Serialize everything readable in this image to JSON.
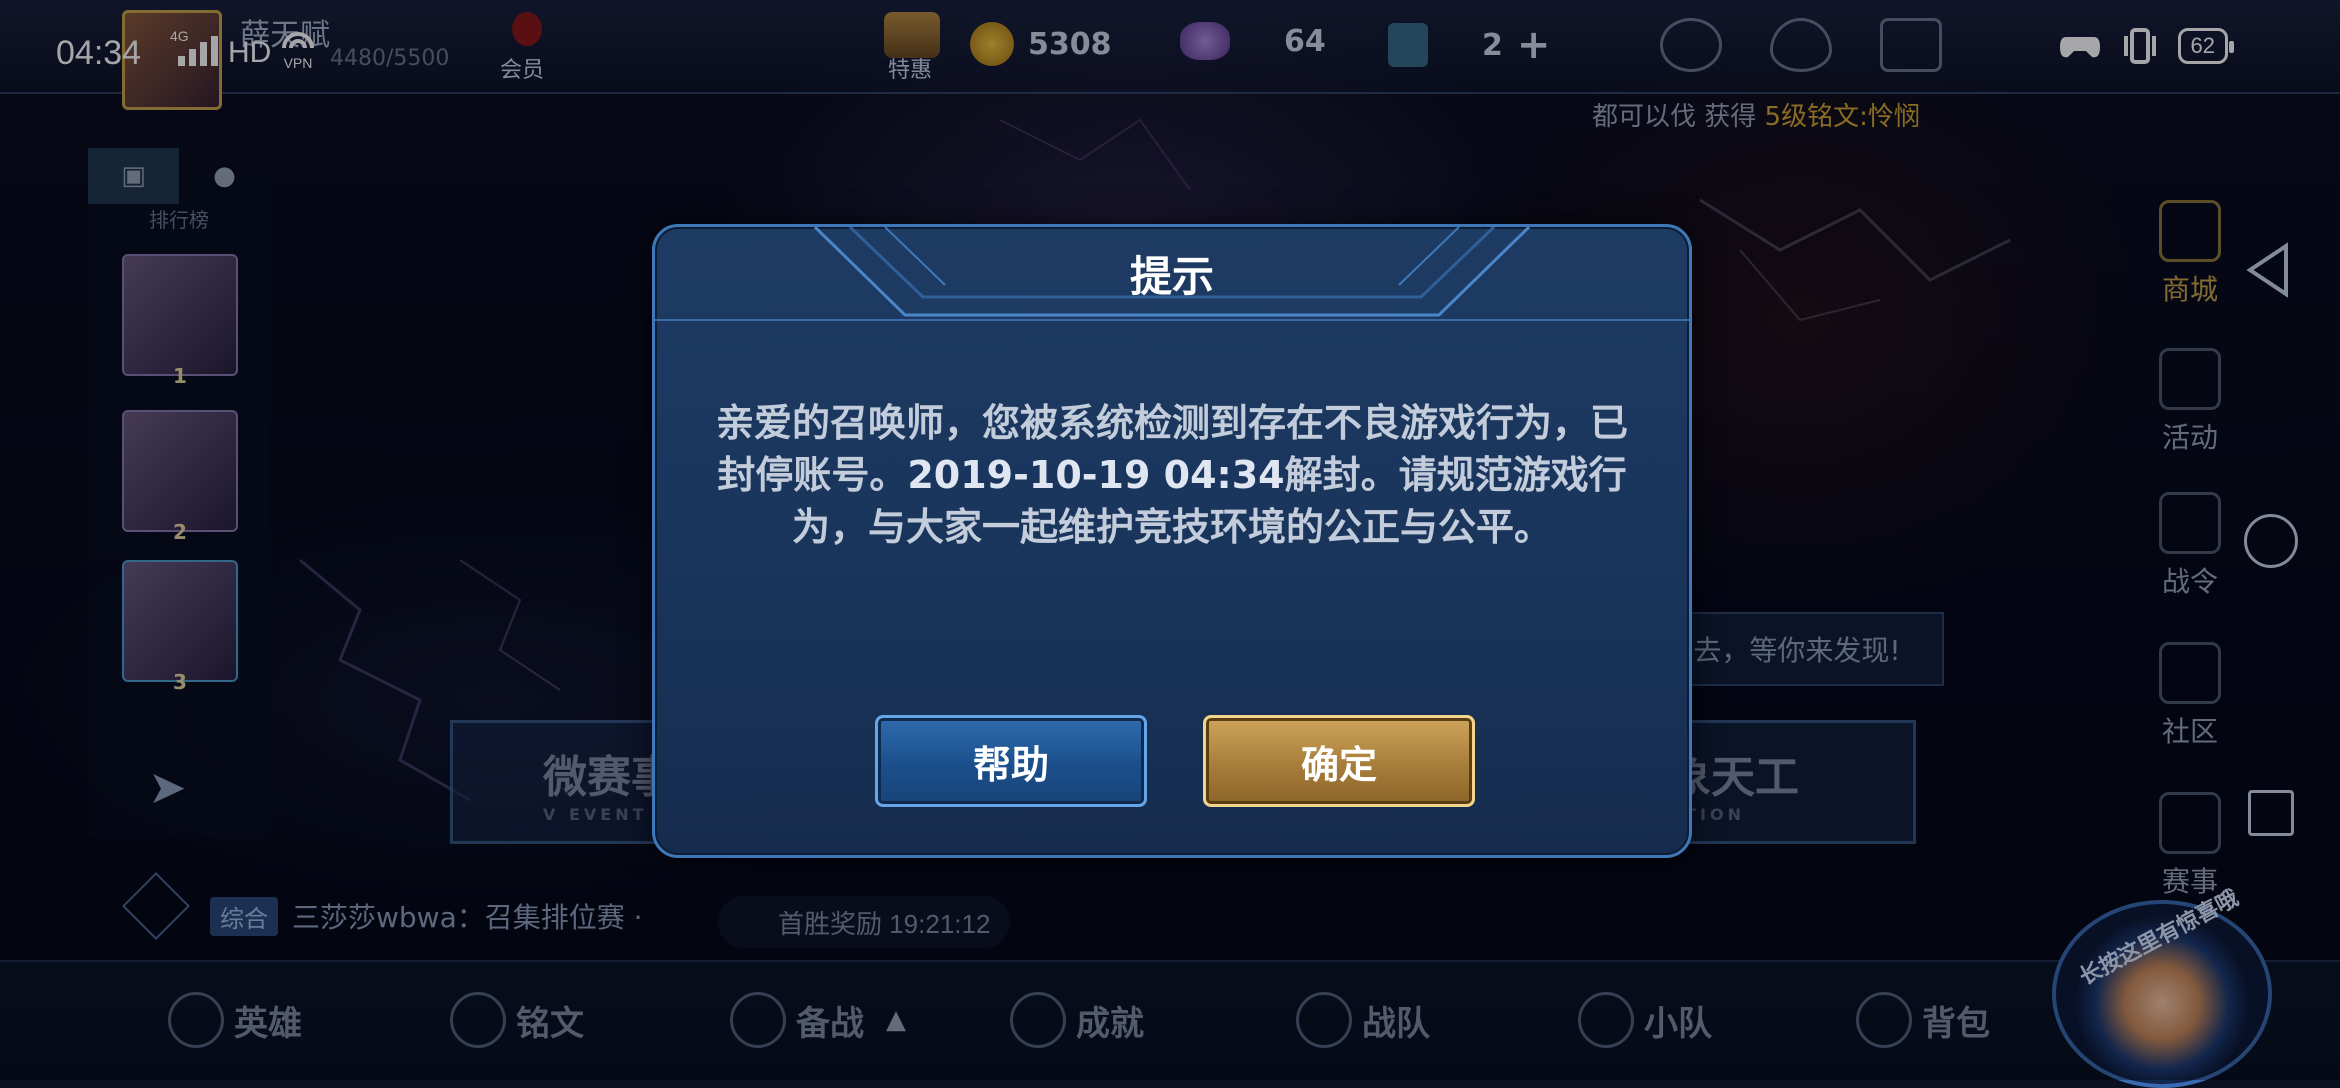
{
  "status_bar": {
    "time": "04:34",
    "network": "4G",
    "hd": "HD",
    "vpn": "VPN",
    "battery": "62"
  },
  "top_bar": {
    "player_name": "薛天赋",
    "exp": "4480/5500",
    "vip_label": "会员",
    "special_label": "特惠",
    "gold": "5308",
    "diamonds": "64",
    "tickets": "2"
  },
  "marquee": {
    "text": "都可以伐 获得 ",
    "highlight": "5级铭文:怜悯"
  },
  "left_panel": {
    "title": "排行榜",
    "ranks": [
      "1",
      "2",
      "3"
    ]
  },
  "right_menu": {
    "items": [
      "商城",
      "活动",
      "战令",
      "社区",
      "赛事"
    ]
  },
  "banners": {
    "left": "微赛事",
    "left_sub": "V EVENT",
    "right": "万象天工",
    "right_sub": "CREATION",
    "hint": "去，等你来发现!"
  },
  "chat": {
    "channel": "综合",
    "message": "三莎莎wbwa：召集排位赛 ·",
    "reward": "首胜奖励 19:21:12"
  },
  "bottom_nav": {
    "items": [
      "英雄",
      "铭文",
      "备战",
      "成就",
      "战队",
      "小队",
      "背包"
    ]
  },
  "corner_label": "长按这里有惊喜哦",
  "dialog": {
    "title": "提示",
    "message_part1": "亲爱的召唤师，您被系统检测到存在不良游戏行为，已封停账号。",
    "date": "2019-10-19 04:34",
    "message_part2": "解封。请规范游戏行为，与大家一起维护竞技环境的公正与公平。",
    "help_label": "帮助",
    "confirm_label": "确定"
  }
}
